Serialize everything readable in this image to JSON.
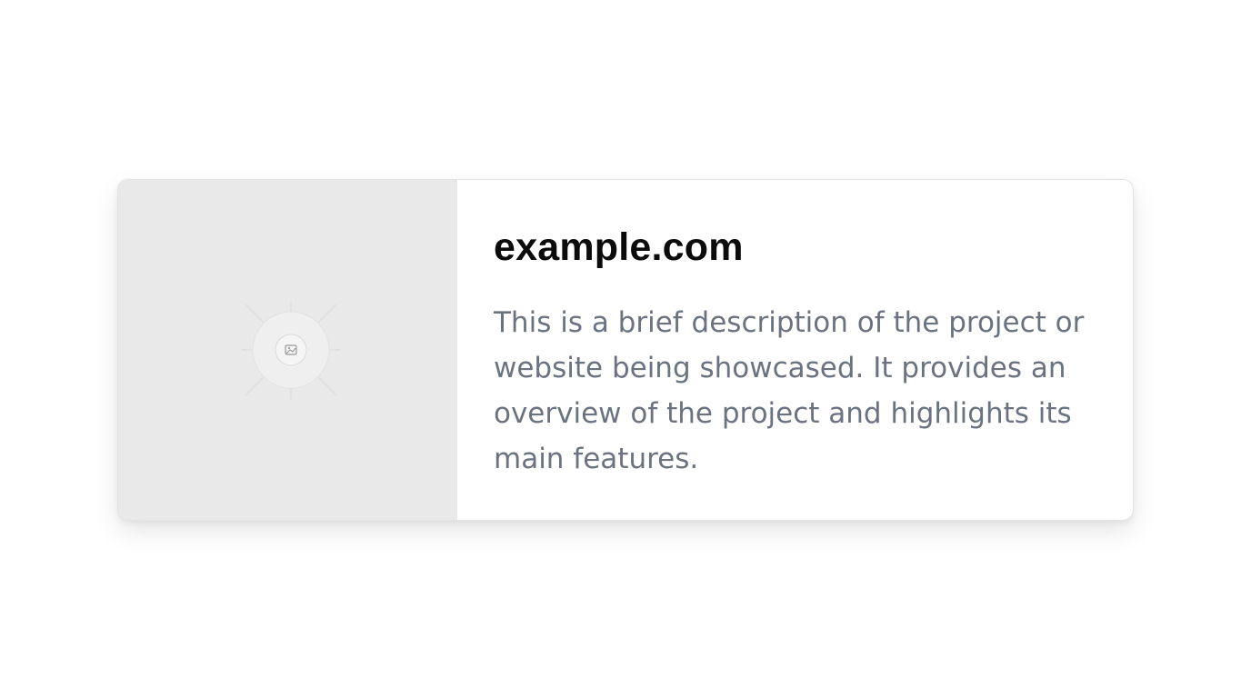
{
  "card": {
    "image_icon": "image-placeholder-icon",
    "title": "example.com",
    "description": "This is a brief description of the project or website being showcased. It provides an overview of the project and highlights its main features."
  },
  "colors": {
    "title": "#0b0b0c",
    "description": "#6b7280",
    "thumbnail_bg": "#e9e9e9",
    "page_bg": "#ffffff"
  }
}
